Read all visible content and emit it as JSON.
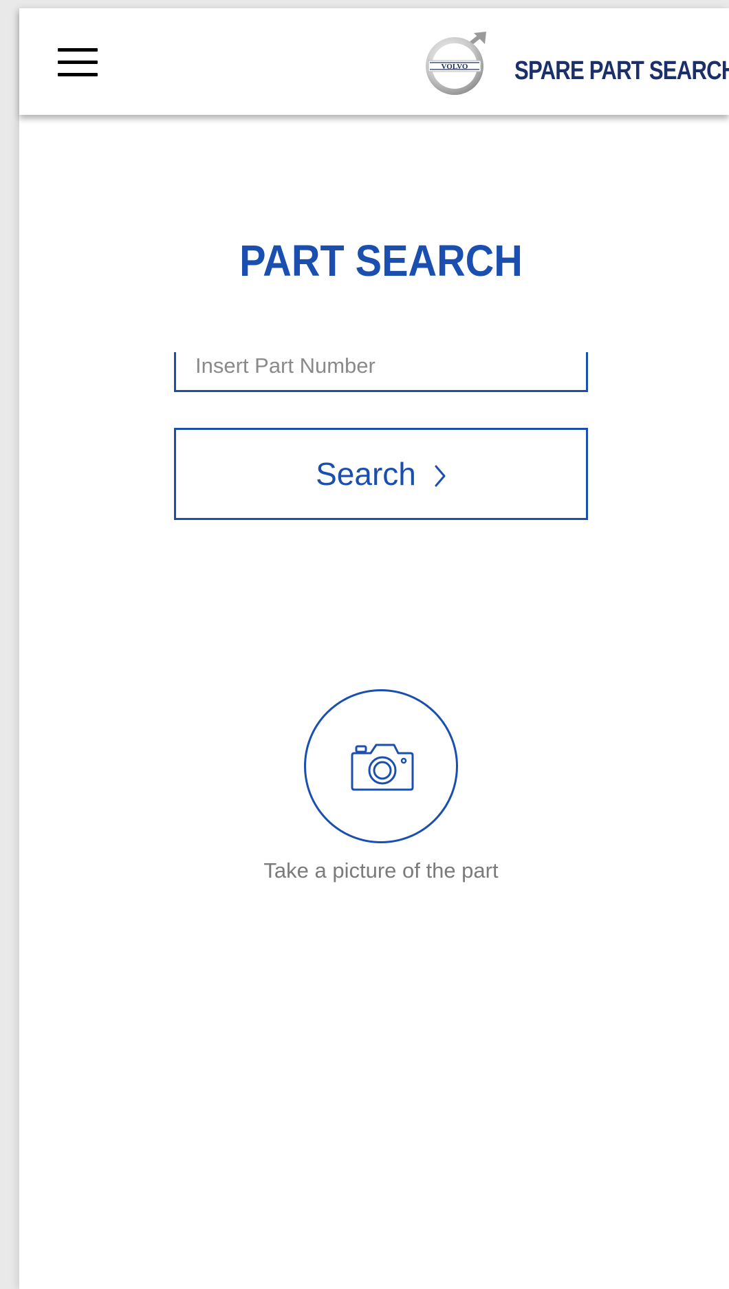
{
  "header": {
    "menu_icon": "hamburger-menu-icon",
    "logo_icon": "volvo-logo-icon",
    "logo_text": "VOLVO",
    "app_title": "SPARE PART SEARCH"
  },
  "main": {
    "title": "PART SEARCH",
    "part_number_input": {
      "placeholder": "Insert Part Number",
      "value": ""
    },
    "search_button": {
      "label": "Search",
      "icon": "chevron-right-icon"
    },
    "camera": {
      "icon": "camera-icon",
      "caption": "Take a picture of the part"
    }
  },
  "colors": {
    "accent": "#1a4fb0",
    "header_title": "#1b2f6b",
    "caption_gray": "#7b7b7b",
    "placeholder_gray": "#8a8a8a"
  }
}
